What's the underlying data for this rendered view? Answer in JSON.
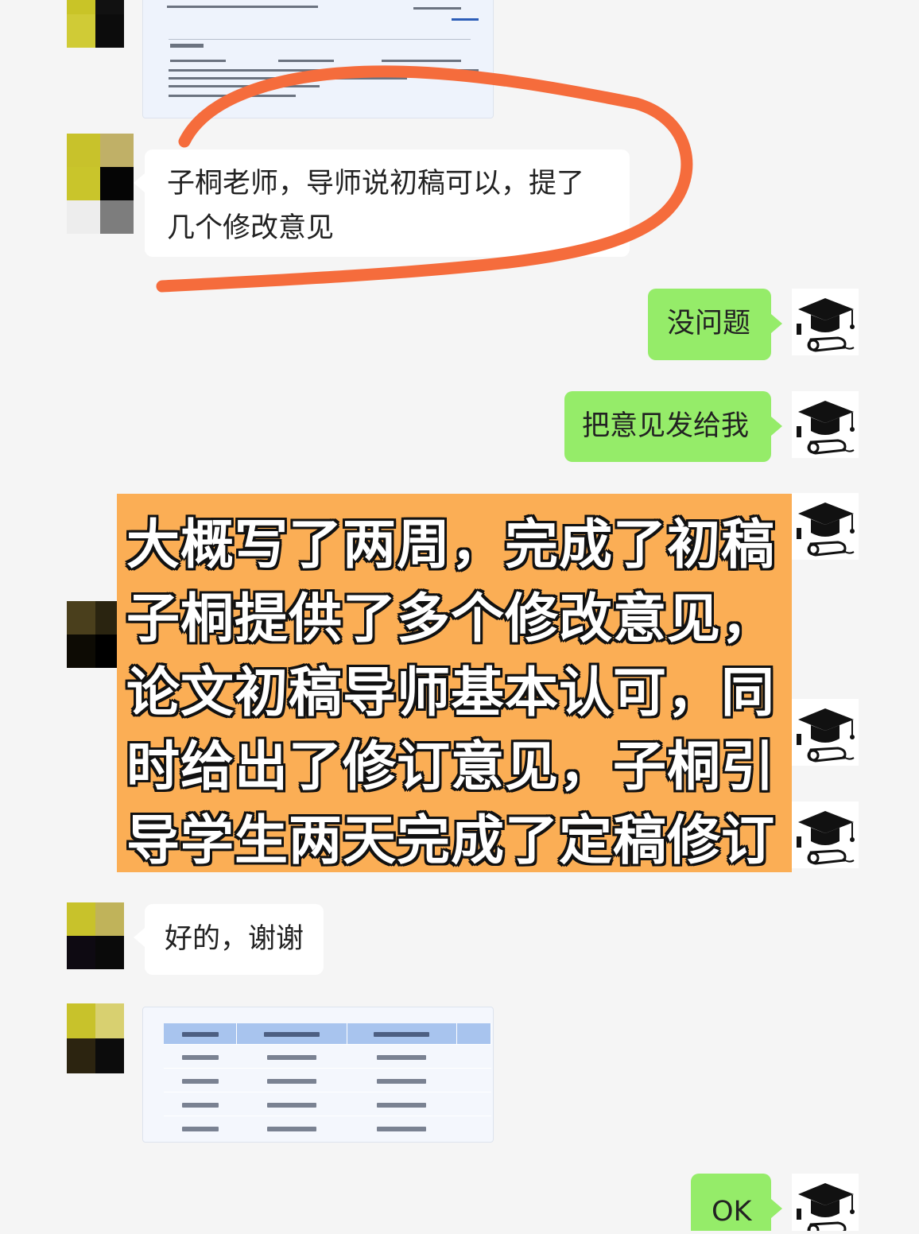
{
  "messages": {
    "m1": "子桐老师，导师说初稿可以，提了几个修改意见",
    "m2": "没问题",
    "m3": "把意见发给我",
    "m4": "好的，谢谢",
    "m5": "OK"
  },
  "m1_lines": [
    "子桐老师，导师说初稿可以，提了",
    "几个修改意见"
  ],
  "overlay_lines": [
    "大概写了两周，完成了初稿",
    "子桐提供了多个修改意见，",
    "论文初稿导师基本认可，同",
    "时给出了修订意见，子桐引",
    "导学生两天完成了定稿修订"
  ],
  "icons": {
    "teacher_avatar": "graduation-cap-icon",
    "student_avatar": "blurred-avatar"
  },
  "colors": {
    "chat_background": "#f5f5f5",
    "incoming_bubble": "#ffffff",
    "outgoing_bubble": "#95ec69",
    "overlay_background": "#fbae55",
    "annotation_stroke": "#f56c3c"
  }
}
